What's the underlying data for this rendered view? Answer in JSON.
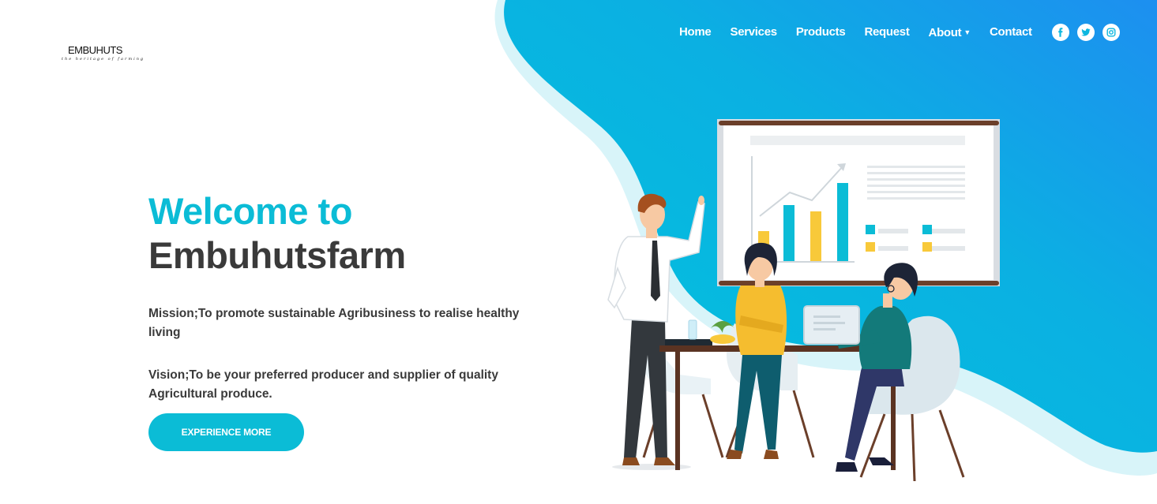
{
  "brand": {
    "logo_title": "EMBUHUTS",
    "logo_tagline": "the heritage of farming"
  },
  "nav": {
    "items": [
      {
        "label": "Home"
      },
      {
        "label": "Services"
      },
      {
        "label": "Products"
      },
      {
        "label": "Request"
      },
      {
        "label": "About",
        "has_dropdown": true
      },
      {
        "label": "Contact"
      }
    ],
    "socials": [
      {
        "name": "facebook-icon"
      },
      {
        "name": "twitter-icon"
      },
      {
        "name": "instagram-icon"
      }
    ]
  },
  "hero": {
    "welcome": "Welcome to",
    "brand_name": "Embuhutsfarm",
    "mission": "Mission;To promote sustainable Agribusiness to realise healthy living",
    "vision": "Vision;To be your preferred producer and supplier of quality Agricultural produce.",
    "cta_label": "EXPERIENCE MORE"
  },
  "colors": {
    "accent": "#0bbcd6",
    "gradient_start": "#00c5dc",
    "gradient_end": "#1d8ff0",
    "text_dark": "#3a3a3a"
  }
}
